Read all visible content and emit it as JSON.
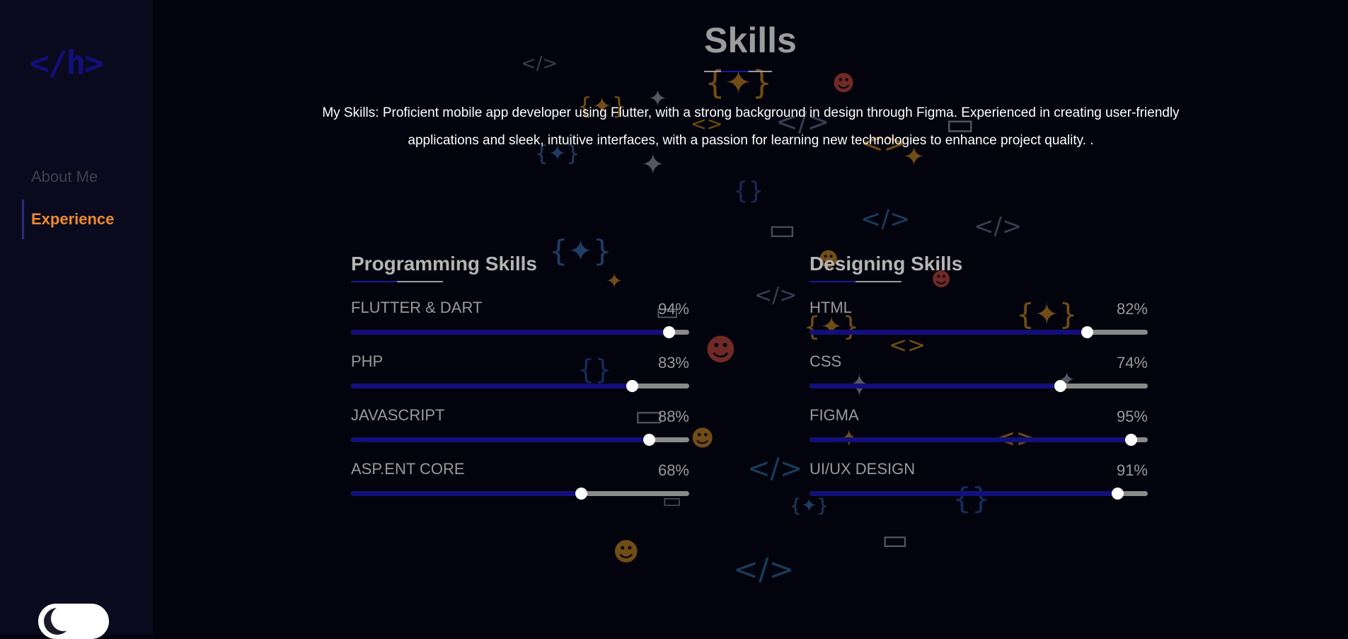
{
  "sidebar": {
    "logo": "</h>",
    "nav": [
      {
        "label": "About Me",
        "active": false
      },
      {
        "label": "Experience",
        "active": true
      }
    ],
    "theme_toggle": "moon-icon"
  },
  "main": {
    "title": "Skills",
    "description": "My Skills: Proficient mobile app developer using Flutter, with a strong background in design through Figma. Experienced in creating user-friendly applications and sleek, intuitive interfaces, with a passion for learning new technologies to enhance project quality. .",
    "programming": {
      "title": "Programming Skills",
      "skills": [
        {
          "name": "FLUTTER & DART",
          "percent_label": "94%",
          "value": 94
        },
        {
          "name": "PHP",
          "percent_label": "83%",
          "value": 83
        },
        {
          "name": "JAVASCRIPT",
          "percent_label": "88%",
          "value": 88
        },
        {
          "name": "ASP.ENT CORE",
          "percent_label": "68%",
          "value": 68
        }
      ]
    },
    "designing": {
      "title": "Designing Skills",
      "skills": [
        {
          "name": "HTML",
          "percent_label": "82%",
          "value": 82
        },
        {
          "name": "CSS",
          "percent_label": "74%",
          "value": 74
        },
        {
          "name": "FIGMA",
          "percent_label": "95%",
          "value": 95
        },
        {
          "name": "UI/UX DESIGN",
          "percent_label": "91%",
          "value": 91
        }
      ]
    }
  },
  "colors": {
    "accent": "#f08a2c",
    "bar_fill": "#12107a",
    "bar_track": "#8a8a8a",
    "background": "#03030d",
    "sidebar": "#0a0a1e"
  }
}
